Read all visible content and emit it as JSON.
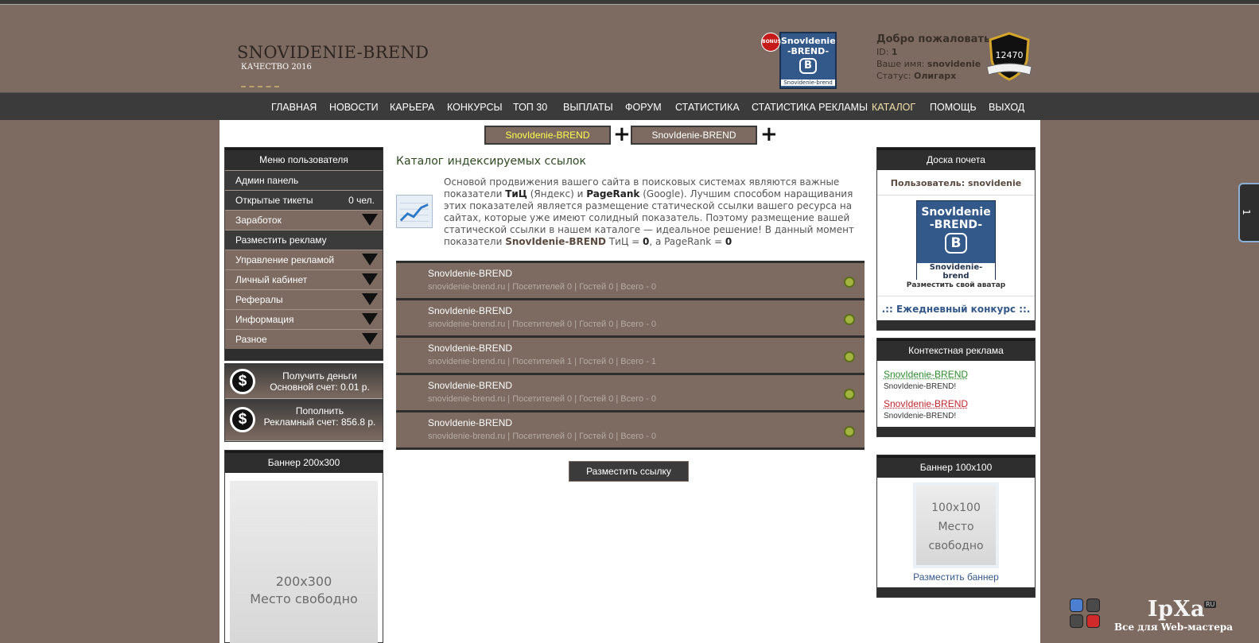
{
  "header": {
    "logo_title": "SNOVIDENIE-BREND",
    "logo_sub": "КАЧЕСТВО 2016",
    "bonus_badge": "BONUS",
    "vk_logo": {
      "line1": "Snovldenie",
      "line2": "-BREND-",
      "badge": "B",
      "line3": "Snovidenie-brend"
    },
    "welcome": {
      "title": "Добро пожаловать",
      "id_label": "ID:",
      "id_value": "1",
      "name_label": "Ваше имя:",
      "name_value": "snovidenie",
      "status_label": "Статус:",
      "status_value": "Олигарх"
    },
    "shield_value": "12470"
  },
  "nav": {
    "items": [
      "ГЛАВНАЯ",
      "НОВОСТИ",
      "КАРЬЕРА",
      "КОНКУРСЫ",
      "ТОП 30",
      "ВЫПЛАТЫ",
      "ФОРУМ",
      "СТАТИСТИКА",
      "СТАТИСТИКА РЕКЛАМЫ",
      "КАТАЛОГ",
      "ПОМОЩЬ",
      "ВЫХОД"
    ],
    "active": "КАТАЛОГ"
  },
  "top_tabs": [
    "SnovIdenie-BREND",
    "SnovIdenie-BREND"
  ],
  "left_menu": {
    "title": "Меню пользователя",
    "items": [
      {
        "label": "Админ панель",
        "count": ""
      },
      {
        "label": "Открытые тикеты",
        "count": "0 чел."
      },
      {
        "label": "Заработок",
        "count": ""
      },
      {
        "label": "Разместить рекламу",
        "count": ""
      },
      {
        "label": "Управление рекламой",
        "count": ""
      },
      {
        "label": "Личный кабинет",
        "count": ""
      },
      {
        "label": "Рефералы",
        "count": ""
      },
      {
        "label": "Информация",
        "count": ""
      },
      {
        "label": "Разное",
        "count": ""
      }
    ]
  },
  "money": {
    "get_label": "Получить деньги",
    "main_account": "Основной счет: 0.01 р.",
    "topup_label": "Пополнить",
    "ad_account": "Рекламный счет: 856.8 р."
  },
  "banner200": {
    "title": "Баннер 200x300",
    "size": "200x300",
    "free": "Место свободно"
  },
  "catalog": {
    "title": "Каталог индексируемых ссылок",
    "desc_1": "Основой продвижения вашего сайта в поисковых системах являются важные показатели ",
    "tic": "ТиЦ",
    "desc_2": " (Яндекс) и ",
    "pagerank": "PageRank",
    "desc_3": " (Google). Лучшим способом наращивания этих показателей является размещение статической ссылки вашего ресурса на сайтах, которые уже имеют солидный показатель. Поэтому размещение вашей статической ссылки в нашем каталоге — идеальное решение! В данный момент показатели ",
    "brand": "SnovIdenie-BREND",
    "desc_4": " ТиЦ = ",
    "tic_value": "0",
    "desc_5": ", а PageRank = ",
    "pr_value": "0",
    "rows": [
      {
        "name": "SnovIdenie-BREND",
        "stats": "snovidenie-brend.ru | Посетителей 0 | Гостей 0 | Всего - 0"
      },
      {
        "name": "SnovIdenie-BREND",
        "stats": "snovidenie-brend.ru | Посетителей 0 | Гостей 0 | Всего - 0"
      },
      {
        "name": "SnovIdenie-BREND",
        "stats": "snovidenie-brend.ru | Посетителей 1 | Гостей 0 | Всего - 1"
      },
      {
        "name": "SnovIdenie-BREND",
        "stats": "snovidenie-brend.ru | Посетителей 0 | Гостей 0 | Всего - 0"
      },
      {
        "name": "SnovIdenie-BREND",
        "stats": "snovidenie-brend.ru | Посетителей 0 | Гостей 0 | Всего - 0"
      }
    ],
    "button": "Разместить ссылку"
  },
  "honor": {
    "title": "Доска почета",
    "user_label": "Пользователь: snovidenie",
    "avatar": {
      "line1": "Snovldenie",
      "line2": "-BREND-",
      "badge": "B",
      "line3": "Snovidenie-brend"
    },
    "avatar_caption": "Разместить свой аватар",
    "daily": ".:: Ежедневный конкурс ::."
  },
  "context_ads": {
    "title": "Контекстная реклама",
    "ads": [
      {
        "link": "SnovIdenie-BREND",
        "text": "SnovIdenie-BREND!"
      },
      {
        "link": "SnovIdenie-BREND",
        "text": "SnovIdenie-BREND!"
      }
    ]
  },
  "banner100": {
    "title": "Баннер 100x100",
    "size": "100x100",
    "free_1": "Место",
    "free_2": "свободно",
    "caption": "Разместить баннер"
  },
  "side_tab": "1",
  "ipxa": {
    "word": "IpXa",
    "ru": "RU",
    "tagline": "Все для Web-мастера"
  },
  "colors": {
    "page_bg": "#7d6b61",
    "dark": "#3b3b3b",
    "accent_yellow": "#ffff4d",
    "link_blue": "#33598a",
    "ad_green": "#2c8a2c",
    "ad_red": "#c2262d"
  }
}
